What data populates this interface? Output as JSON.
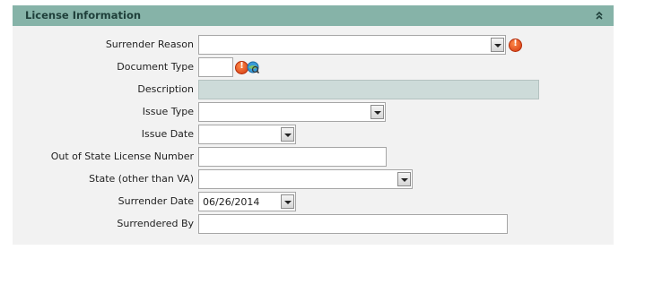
{
  "panel": {
    "title": "License Information",
    "collapse_icon": "double-chevron-up-icon"
  },
  "fields": {
    "surrender_reason": {
      "label": "Surrender Reason",
      "value": ""
    },
    "document_type": {
      "label": "Document Type",
      "value": ""
    },
    "description": {
      "label": "Description",
      "value": ""
    },
    "issue_type": {
      "label": "Issue Type",
      "value": ""
    },
    "issue_date": {
      "label": "Issue Date",
      "value": ""
    },
    "out_of_state_license_number": {
      "label": "Out of State License Number",
      "value": ""
    },
    "state": {
      "label": "State (other than VA)",
      "value": ""
    },
    "surrender_date": {
      "label": "Surrender Date",
      "value": "06/26/2014"
    },
    "surrendered_by": {
      "label": "Surrendered By",
      "value": ""
    }
  },
  "colors": {
    "header_bg": "#86b3a8",
    "panel_bg": "#f2f2f2",
    "readonly_bg": "#cddbd9",
    "warning": "#d2380f"
  }
}
